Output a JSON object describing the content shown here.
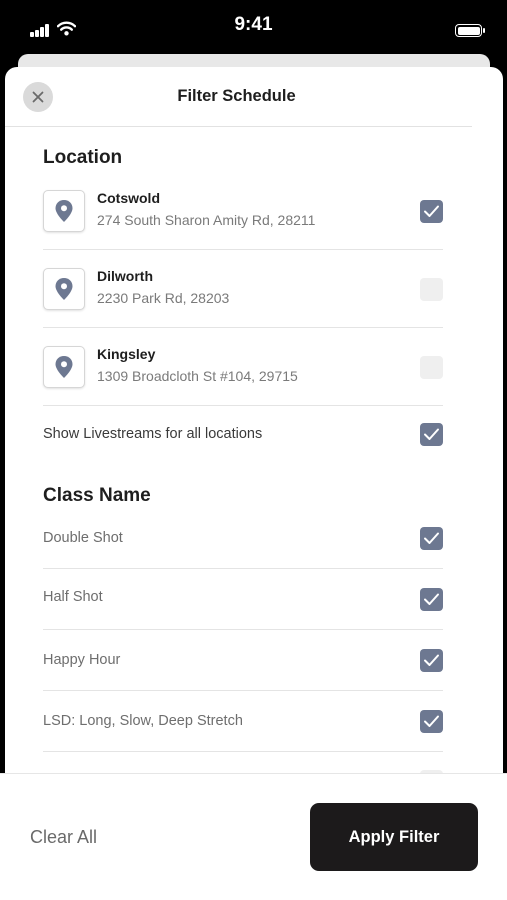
{
  "status": {
    "time": "9:41",
    "signal_icon": "signal-icon",
    "wifi_icon": "wifi-icon",
    "battery_icon": "battery-icon"
  },
  "header": {
    "title": "Filter Schedule",
    "close_icon": "close-icon"
  },
  "location": {
    "title": "Location",
    "items": [
      {
        "name": "Cotswold",
        "address": "274 South Sharon Amity Rd, 28211",
        "checked": true,
        "icon": "location-pin-icon"
      },
      {
        "name": "Dilworth",
        "address": "2230 Park Rd, 28203",
        "checked": false,
        "icon": "location-pin-icon"
      },
      {
        "name": "Kingsley",
        "address": "1309 Broadcloth St #104, 29715",
        "checked": false,
        "icon": "location-pin-icon"
      }
    ],
    "livestream_label": "Show Livestreams for all locations",
    "livestream_checked": true
  },
  "class_name": {
    "title": "Class Name",
    "items": [
      {
        "label": "Double Shot",
        "checked": true
      },
      {
        "label": "Half Shot",
        "checked": true
      },
      {
        "label": "Happy Hour",
        "checked": true
      },
      {
        "label": "LSD: Long, Slow, Deep Stretch",
        "checked": true
      }
    ]
  },
  "footer": {
    "clear_label": "Clear All",
    "apply_label": "Apply Filter"
  },
  "colors": {
    "checkbox_checked": "#6d7891",
    "checkbox_unchecked": "#efefef",
    "apply_button": "#1c1a1b",
    "pin": "#6d7891"
  }
}
